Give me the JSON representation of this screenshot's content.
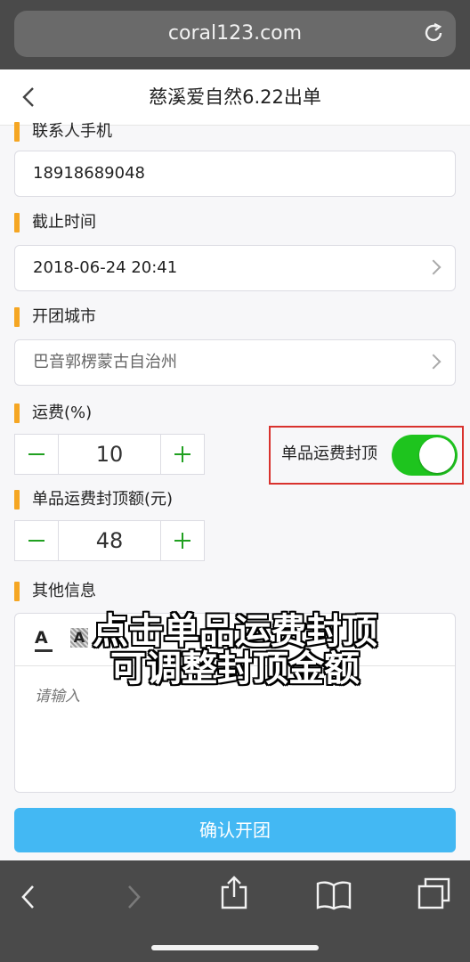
{
  "browser": {
    "url": "coral123.com",
    "toolbar_icons": [
      "back-arrow-icon",
      "forward-arrow-icon",
      "share-icon",
      "bookmarks-icon",
      "tabs-icon"
    ]
  },
  "nav": {
    "title": "慈溪爱自然6.22出单"
  },
  "form": {
    "contact_phone_label": "联系人手机",
    "contact_phone_value": "18918689048",
    "deadline_label": "截止时间",
    "deadline_value": "2018-06-24 20:41",
    "city_label": "开团城市",
    "city_value": "巴音郭楞蒙古自治州",
    "shipping_label": "运费(%)",
    "shipping_value": "10",
    "cap_toggle_label": "单品运费封顶",
    "cap_toggle_on": true,
    "cap_amount_label": "单品运费封顶额(元)",
    "cap_amount_value": "48",
    "other_info_label": "其他信息",
    "editor_placeholder": "请输入",
    "submit_label": "确认开团"
  },
  "caption": {
    "line1": "点击单品运费封顶",
    "line2": "可调整封顶金额"
  },
  "colors": {
    "accent_orange": "#f5a623",
    "toggle_green": "#1ec41e",
    "stepper_green": "#20a020",
    "submit_blue": "#43b8f3",
    "highlight_red": "#d9322e"
  }
}
